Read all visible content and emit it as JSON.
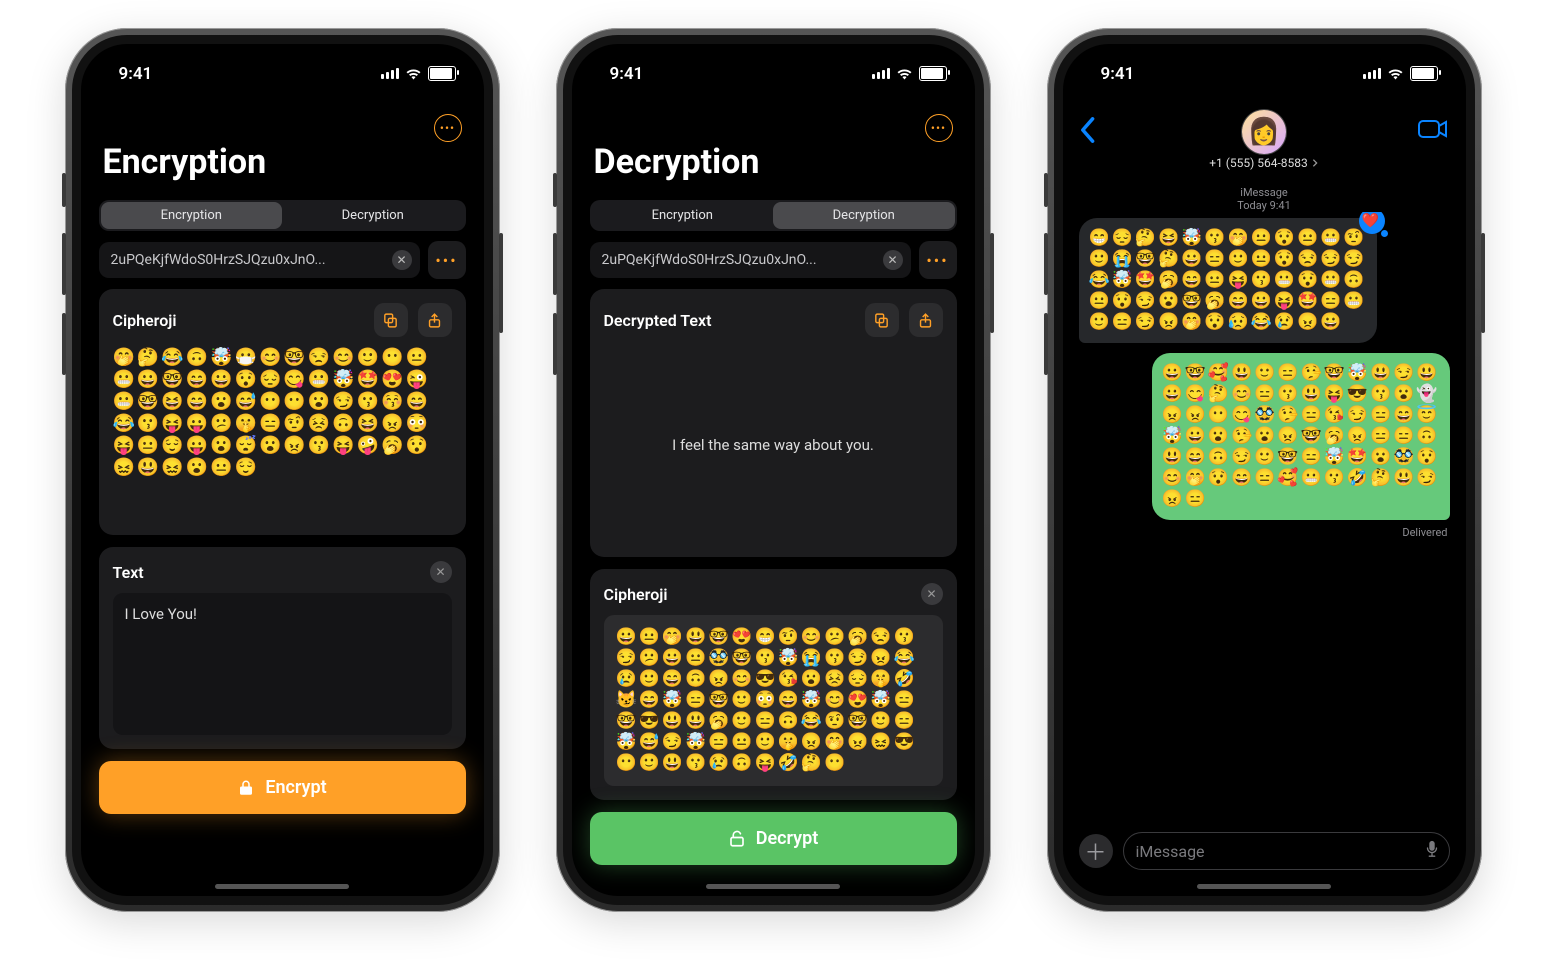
{
  "status": {
    "time": "9:41"
  },
  "screen1": {
    "title": "Encryption",
    "tabs": {
      "encrypt": "Encryption",
      "decrypt": "Decryption",
      "selected": "encrypt"
    },
    "key": "2uPQeKjfWdoS0HrzSJQzu0xJnO...",
    "cipher_card": {
      "label": "Cipheroji",
      "emoji": "🤭🤔😂🙃🤯😷😊🤓😒😊🙂😶😐😬😀🤓😄😀😯😔😋😬🤯🤩😍😜😬🤓😆😄😮😅😶😶😮😏😗😚😄😂😗😝😛😕🤫😑🤨😣🙃😆😠😳😝😐😌😛😮😴😮😠😗😝🤪🥱😯😖😃😖😮😐😌"
    },
    "text_card": {
      "label": "Text",
      "value": "I Love You!"
    },
    "action": "Encrypt"
  },
  "screen2": {
    "title": "Decryption",
    "tabs": {
      "encrypt": "Encryption",
      "decrypt": "Decryption",
      "selected": "decrypt"
    },
    "key": "2uPQeKjfWdoS0HrzSJQzu0xJnO...",
    "decrypted_card": {
      "label": "Decrypted Text",
      "value": "I feel the same way about you."
    },
    "cipher_card": {
      "label": "Cipheroji",
      "emoji": "😀😐🤭😃🤓😍😁🤨😊😕🥱😒😗😏😕😀😐🥸🤓😗🤯😭😗😏😠😂😢🙂😄🙃😠😊😎😘😮😣😔🤫🤣😼😄🤯😑🤓🙂😳😄🤯😊😍🤯😑🤓😎😃😃🥱🙂😑🙃😂🤨🤓🙂😑🤯😅😏🤯😑😐🙂🤫😠🤭😠😖😎😶🙂😃😗😢🙃😝🤣🤔😶"
    },
    "action": "Decrypt"
  },
  "screen3": {
    "contact_number": "+1 (555) 564-8583",
    "meta1": "iMessage",
    "meta2": "Today 9:41",
    "incoming": "😁😔🤔😆🤯😗🤭😐😯😐😬🤨🙂😭🤓🤔😀😑🙂😐😯😒😏😏😂🤯🤩🥱😄😐😝😗😬😯😬🙃😐😯😏😮🤓🥱😄😀😝🤩😑😬🙂😑😏😠🤭😯😥😂😢😠😀",
    "tapback_heart": "❤️",
    "outgoing": "😀🤓🥰😃🙂😑🤥🤓🤯😃😏😃😀😋🤔😊😑😗😃😝😎😗😮👻😠😠😶😋🥸🤥😑😘😏😑😄😇🤯😀😮🤥😮😠🤓🥱😠😑😑🙃😃😄🙃😏🙂🤓😑🤯🤩😮🥸😯😊🤭😯😄😑🥰😬😗🤣🤔😃😏😠😑",
    "delivered": "Delivered",
    "input_placeholder": "iMessage"
  }
}
